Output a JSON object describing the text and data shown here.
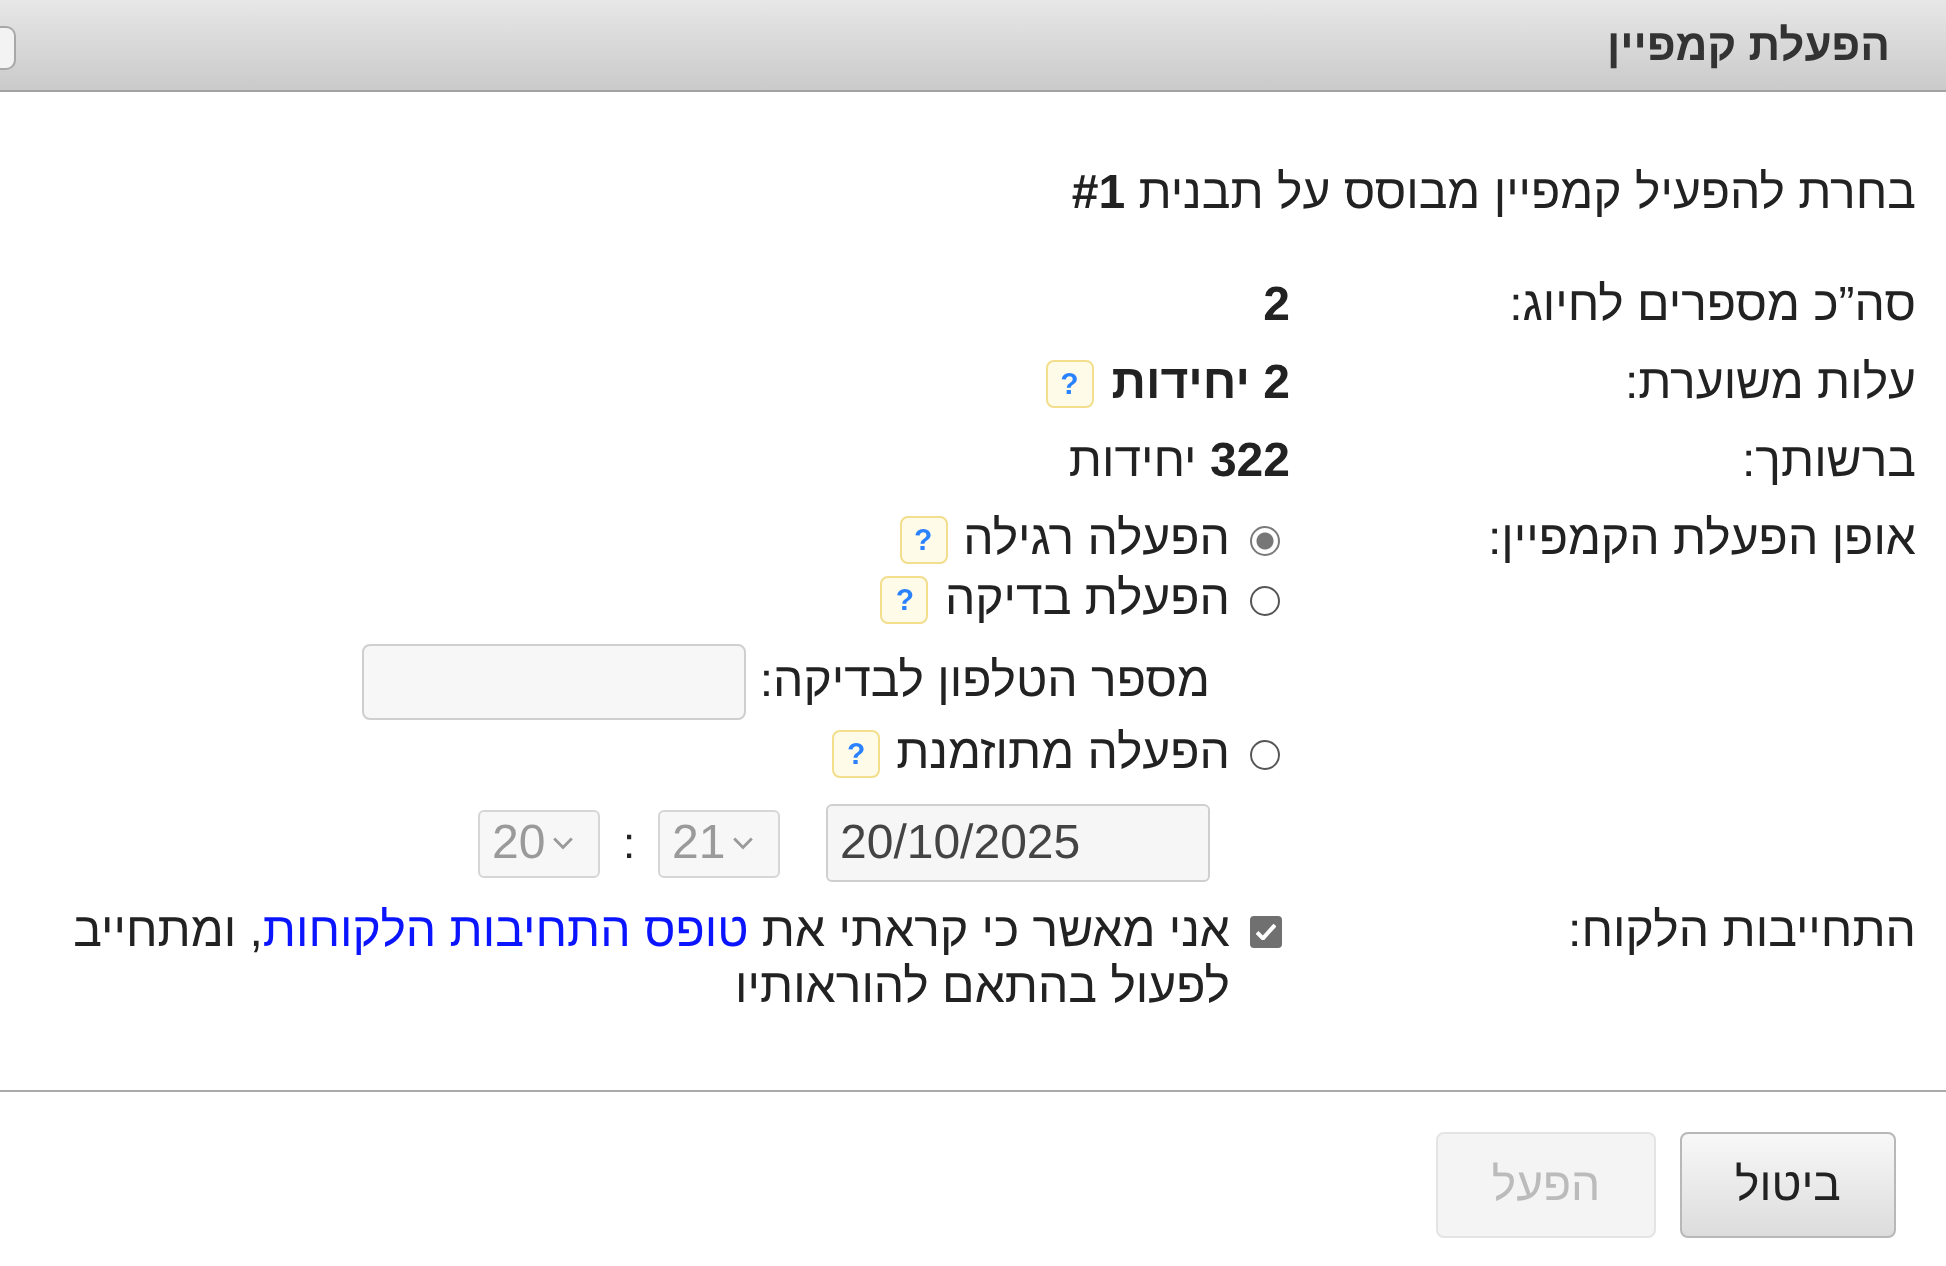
{
  "window": {
    "title": "הפעלת קמפיין"
  },
  "intro": "בחרת להפעיל קמפיין מבוסס על תבנית **#1**",
  "summary": [
    {
      "label": "סה”כ מספרים לחיוג:",
      "value": "2",
      "bold": true
    },
    {
      "label": "עלות משוערת:",
      "value": "2 יחידות",
      "bold": true,
      "help": "?"
    },
    {
      "label": "ברשותך:",
      "value": "**322** יחידות",
      "bold": false
    }
  ],
  "mode": {
    "label": "אופן הפעלת הקמפיין:",
    "options": [
      {
        "label": "הפעלה רגילה",
        "selected": true,
        "help": "?"
      },
      {
        "label": "הפעלת בדיקה",
        "selected": false,
        "help": "?",
        "phone_field": {
          "label": "מספר הטלפון לבדיקה:"
        }
      },
      {
        "label": "הפעלה מתוזמנת",
        "selected": false,
        "help": "?",
        "schedule": {
          "date": "20/10/2025",
          "time_fields": [
            {
              "value": "21",
              "disabled": true
            },
            {
              "value": "20",
              "disabled": true
            }
          ],
          "separator": ":"
        }
      }
    ]
  },
  "commitment": {
    "label": "התחייבות הלקוח:",
    "checked": true,
    "text_before": "אני מאשר כי קראתי את",
    "link": "טופס התחיבות הלקוחות",
    "text_after": ", ומתחייב לפעול בהתאם להוראותיו"
  },
  "buttons": [
    {
      "label": "ביטול",
      "disabled": false
    },
    {
      "label": "הפעל",
      "disabled": true
    }
  ]
}
